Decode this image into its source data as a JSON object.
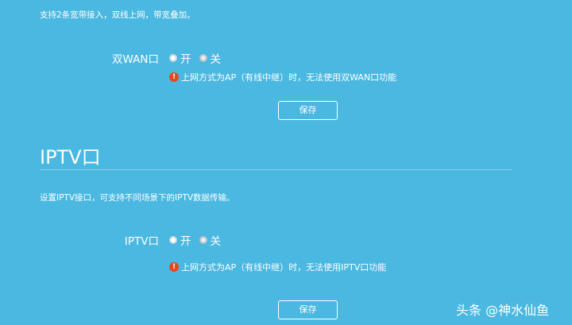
{
  "dual_wan": {
    "description": "支持2条宽带接入，双线上网，带宽叠加。",
    "label": "双WAN口",
    "options": [
      "开",
      "关"
    ],
    "selected": "关",
    "warning": "上网方式为AP（有线中继）时，无法使用双WAN口功能",
    "save_label": "保存"
  },
  "iptv": {
    "title": "IPTV口",
    "description": "设置IPTV接口，可支持不同场景下的IPTV数据传输。",
    "label": "IPTV口",
    "options": [
      "开",
      "关"
    ],
    "selected": "关",
    "warning": "上网方式为AP（有线中继）时，无法使用IPTV口功能",
    "save_label": "保存"
  },
  "watermark": {
    "text": "头条 @神水仙鱼"
  },
  "icons": {
    "warning": "exclamation-icon"
  },
  "colors": {
    "background": "#4ab8e0",
    "warning_icon": "#e8471d",
    "divider": "#87d0ec"
  }
}
